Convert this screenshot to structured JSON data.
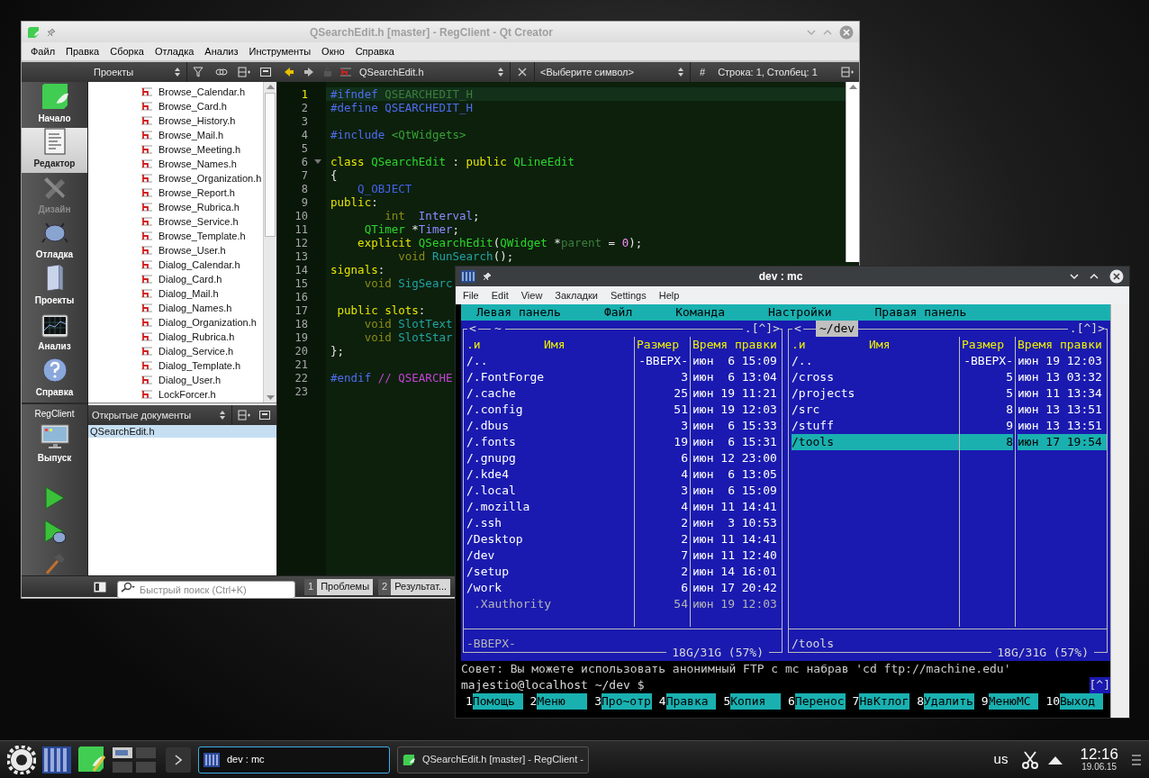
{
  "qt_creator": {
    "window_title": "QSearchEdit.h [master] - RegClient - Qt Creator",
    "menu": [
      "Файл",
      "Правка",
      "Сборка",
      "Отладка",
      "Анализ",
      "Инструменты",
      "Окно",
      "Справка"
    ],
    "toolbar": {
      "projects_combo": "Проекты",
      "file_combo": "QSearchEdit.h",
      "symbol_combo": "<Выберите символ>",
      "hash": "#",
      "position": "Строка: 1, Столбец: 1"
    },
    "modes": [
      {
        "label": "Начало",
        "kind": "welcome",
        "selected": false,
        "disabled": false
      },
      {
        "label": "Редактор",
        "kind": "edit",
        "selected": true,
        "disabled": false
      },
      {
        "label": "Дизайн",
        "kind": "design",
        "selected": false,
        "disabled": true
      },
      {
        "label": "Отладка",
        "kind": "debug",
        "selected": false,
        "disabled": false
      },
      {
        "label": "Проекты",
        "kind": "projects",
        "selected": false,
        "disabled": false
      },
      {
        "label": "Анализ",
        "kind": "analyze",
        "selected": false,
        "disabled": false
      },
      {
        "label": "Справка",
        "kind": "help",
        "selected": false,
        "disabled": false
      }
    ],
    "project_label": "RegClient",
    "deploy_label": "Выпуск",
    "files": [
      "Browse_Calendar.h",
      "Browse_Card.h",
      "Browse_History.h",
      "Browse_Mail.h",
      "Browse_Meeting.h",
      "Browse_Names.h",
      "Browse_Organization.h",
      "Browse_Report.h",
      "Browse_Rubrica.h",
      "Browse_Service.h",
      "Browse_Template.h",
      "Browse_User.h",
      "Dialog_Calendar.h",
      "Dialog_Card.h",
      "Dialog_Mail.h",
      "Dialog_Names.h",
      "Dialog_Organization.h",
      "Dialog_Rubrica.h",
      "Dialog_Service.h",
      "Dialog_Template.h",
      "Dialog_User.h",
      "LockForcer.h"
    ],
    "open_documents": {
      "title": "Открытые документы",
      "items": [
        {
          "label": "QSearchEdit.h",
          "selected": true
        }
      ]
    },
    "search": {
      "placeholder": "Быстрый поиск (Ctrl+K)"
    },
    "output_tabs": [
      {
        "number": "1",
        "label": "Проблемы"
      },
      {
        "number": "2",
        "label": "Результат..."
      }
    ],
    "editor": {
      "lines": [
        {
          "number": "1",
          "current": true,
          "foldable": false,
          "tokens": [
            {
              "text": "#ifndef",
              "kind": "pre"
            },
            {
              "text": " QSEARCHEDIT_H",
              "kind": "dim"
            }
          ]
        },
        {
          "number": "2",
          "current": false,
          "foldable": false,
          "tokens": [
            {
              "text": "#define QSEARCHEDIT_H",
              "kind": "pre"
            }
          ]
        },
        {
          "number": "3",
          "current": false,
          "foldable": false
        },
        {
          "number": "4",
          "current": false,
          "foldable": false,
          "tokens": [
            {
              "text": "#include",
              "kind": "pre"
            },
            {
              "text": " <QtWidgets>",
              "kind": "inc"
            }
          ]
        },
        {
          "number": "5",
          "current": false,
          "foldable": false
        },
        {
          "number": "6",
          "current": false,
          "foldable": true,
          "tokens": [
            {
              "text": "class",
              "kind": "kw"
            },
            {
              "text": " QSearchEdit",
              "kind": "type"
            },
            {
              "text": " :",
              "kind": "plain"
            },
            {
              "text": " public",
              "kind": "kw"
            },
            {
              "text": " QLineEdit",
              "kind": "type"
            }
          ]
        },
        {
          "number": "7",
          "current": false,
          "foldable": false,
          "tokens": [
            {
              "text": "{",
              "kind": "plain"
            }
          ]
        },
        {
          "number": "8",
          "current": false,
          "foldable": false,
          "tokens": [
            {
              "text": "    Q_OBJECT",
              "kind": "macro"
            }
          ]
        },
        {
          "number": "9",
          "current": false,
          "foldable": false,
          "tokens": [
            {
              "text": "public",
              "kind": "kw"
            },
            {
              "text": ":",
              "kind": "plain"
            }
          ]
        },
        {
          "number": "10",
          "current": false,
          "foldable": false,
          "tokens": [
            {
              "text": "        int",
              "kind": "prim"
            },
            {
              "text": "  Interval",
              "kind": "member"
            },
            {
              "text": ";",
              "kind": "plain"
            }
          ]
        },
        {
          "number": "11",
          "current": false,
          "foldable": false,
          "tokens": [
            {
              "text": "     QTimer",
              "kind": "type"
            },
            {
              "text": " *",
              "kind": "plain"
            },
            {
              "text": "Timer",
              "kind": "member"
            },
            {
              "text": ";",
              "kind": "plain"
            }
          ]
        },
        {
          "number": "12",
          "current": false,
          "foldable": false,
          "tokens": [
            {
              "text": "    explicit",
              "kind": "kw"
            },
            {
              "text": " QSearchEdit",
              "kind": "type"
            },
            {
              "text": "(",
              "kind": "plain"
            },
            {
              "text": "QWidget",
              "kind": "type"
            },
            {
              "text": " *",
              "kind": "plain"
            },
            {
              "text": "parent",
              "kind": "dim"
            },
            {
              "text": " = ",
              "kind": "plain"
            },
            {
              "text": "0",
              "kind": "num"
            },
            {
              "text": ");",
              "kind": "plain"
            }
          ]
        },
        {
          "number": "13",
          "current": false,
          "foldable": false,
          "tokens": [
            {
              "text": "          void",
              "kind": "prim"
            },
            {
              "text": " RunSearch",
              "kind": "func"
            },
            {
              "text": "();",
              "kind": "plain"
            }
          ]
        },
        {
          "number": "14",
          "current": false,
          "foldable": false,
          "tokens": [
            {
              "text": "signals",
              "kind": "kw"
            },
            {
              "text": ":",
              "kind": "plain"
            }
          ]
        },
        {
          "number": "15",
          "current": false,
          "foldable": false,
          "tokens": [
            {
              "text": "     void",
              "kind": "prim"
            },
            {
              "text": " SigSearc",
              "kind": "func"
            }
          ]
        },
        {
          "number": "16",
          "current": false,
          "foldable": false
        },
        {
          "number": "17",
          "current": false,
          "foldable": false,
          "tokens": [
            {
              "text": " public slots",
              "kind": "kw"
            },
            {
              "text": ":",
              "kind": "plain"
            }
          ]
        },
        {
          "number": "18",
          "current": false,
          "foldable": false,
          "tokens": [
            {
              "text": "     void",
              "kind": "prim"
            },
            {
              "text": " SlotText",
              "kind": "func"
            }
          ]
        },
        {
          "number": "19",
          "current": false,
          "foldable": false,
          "tokens": [
            {
              "text": "     void",
              "kind": "prim"
            },
            {
              "text": " SlotStar",
              "kind": "func"
            }
          ]
        },
        {
          "number": "20",
          "current": false,
          "foldable": false,
          "tokens": [
            {
              "text": "};",
              "kind": "plain"
            }
          ]
        },
        {
          "number": "21",
          "current": false,
          "foldable": false
        },
        {
          "number": "22",
          "current": false,
          "foldable": false,
          "tokens": [
            {
              "text": "#endif",
              "kind": "pre"
            },
            {
              "text": " // QSEARCHE",
              "kind": "cmt"
            }
          ]
        },
        {
          "number": "23",
          "current": false,
          "foldable": false
        }
      ]
    }
  },
  "mc": {
    "window_title": "dev : mc",
    "menu": [
      "File",
      "Edit",
      "View",
      "Закладки",
      "Settings",
      "Help"
    ],
    "top_menu": [
      "Левая панель",
      "Файл",
      "Команда",
      "Настройки",
      "Правая панель"
    ],
    "panels": [
      {
        "path": "~",
        "active": false,
        "left_marker": "<",
        "right_marker": ".[^]>",
        "columns": [
          ".и",
          "Имя",
          "Размер",
          "Время правки"
        ],
        "mini_status": "-ВВЕРХ-",
        "disk": "18G/31G (57%)",
        "rows": [
          {
            "name": "/..",
            "size": "-ВВЕРХ-",
            "time": "июн  6 15:09",
            "kind": "dir",
            "selected": false
          },
          {
            "name": "/.FontForge",
            "size": "3",
            "time": "июн  6 13:04",
            "kind": "dir",
            "selected": false
          },
          {
            "name": "/.cache",
            "size": "25",
            "time": "июн 19 11:21",
            "kind": "dir",
            "selected": false
          },
          {
            "name": "/.config",
            "size": "51",
            "time": "июн 19 12:03",
            "kind": "dir",
            "selected": false
          },
          {
            "name": "/.dbus",
            "size": "3",
            "time": "июн  6 15:33",
            "kind": "dir",
            "selected": false
          },
          {
            "name": "/.fonts",
            "size": "19",
            "time": "июн  6 15:31",
            "kind": "dir",
            "selected": false
          },
          {
            "name": "/.gnupg",
            "size": "6",
            "time": "июн 12 23:00",
            "kind": "dir",
            "selected": false
          },
          {
            "name": "/.kde4",
            "size": "4",
            "time": "июн  6 13:05",
            "kind": "dir",
            "selected": false
          },
          {
            "name": "/.local",
            "size": "3",
            "time": "июн  6 15:09",
            "kind": "dir",
            "selected": false
          },
          {
            "name": "/.mozilla",
            "size": "4",
            "time": "июн 11 14:41",
            "kind": "dir",
            "selected": false
          },
          {
            "name": "/.ssh",
            "size": "2",
            "time": "июн  3 10:53",
            "kind": "dir",
            "selected": false
          },
          {
            "name": "/Desktop",
            "size": "2",
            "time": "июн 11 14:41",
            "kind": "dir",
            "selected": false
          },
          {
            "name": "/dev",
            "size": "7",
            "time": "июн 11 12:40",
            "kind": "dir",
            "selected": false
          },
          {
            "name": "/setup",
            "size": "2",
            "time": "июн 14 16:01",
            "kind": "dir",
            "selected": false
          },
          {
            "name": "/work",
            "size": "6",
            "time": "июн 17 20:42",
            "kind": "dir",
            "selected": false
          },
          {
            "name": ".Xauthority",
            "size": "54",
            "time": "июн 19 12:03",
            "kind": "file",
            "selected": false
          }
        ]
      },
      {
        "path": "~/dev",
        "active": true,
        "left_marker": "<",
        "right_marker": ".[^]>",
        "columns": [
          ".и",
          "Имя",
          "Размер",
          "Время правки"
        ],
        "mini_status": "/tools",
        "disk": "18G/31G (57%)",
        "rows": [
          {
            "name": "/..",
            "size": "-ВВЕРХ-",
            "time": "июн 19 12:03",
            "kind": "dir",
            "selected": false
          },
          {
            "name": "/cross",
            "size": "5",
            "time": "июн 13 03:32",
            "kind": "dir",
            "selected": false
          },
          {
            "name": "/projects",
            "size": "5",
            "time": "июн 11 13:34",
            "kind": "dir",
            "selected": false
          },
          {
            "name": "/src",
            "size": "8",
            "time": "июн 13 13:51",
            "kind": "dir",
            "selected": false
          },
          {
            "name": "/stuff",
            "size": "9",
            "time": "июн 13 13:51",
            "kind": "dir",
            "selected": false
          },
          {
            "name": "/tools",
            "size": "8",
            "time": "июн 17 19:54",
            "kind": "dir",
            "selected": true
          }
        ]
      }
    ],
    "hint": "Совет: Вы можете использовать анонимный FTP с mc набрав 'cd ftp://machine.edu'",
    "prompt": "majestio@localhost ~/dev $",
    "prompt_badge": "[^]",
    "fkeys": [
      {
        "number": "1",
        "label": "Помощь"
      },
      {
        "number": "2",
        "label": "Меню"
      },
      {
        "number": "3",
        "label": "Про~отр"
      },
      {
        "number": "4",
        "label": "Правка"
      },
      {
        "number": "5",
        "label": "Копия"
      },
      {
        "number": "6",
        "label": "Перенос"
      },
      {
        "number": "7",
        "label": "НвКтлог"
      },
      {
        "number": "8",
        "label": "Удалить"
      },
      {
        "number": "9",
        "label": "МенюMC"
      },
      {
        "number": "10",
        "label": "Выход"
      }
    ]
  },
  "taskbar": {
    "tasks": [
      {
        "label": "dev : mc",
        "kind": "terminal",
        "selected": true
      },
      {
        "label": "QSearchEdit.h [master] - RegClient -",
        "kind": "qt",
        "selected": false
      }
    ],
    "keyboard": "us",
    "time": "12:16",
    "date": "19.06.15"
  }
}
